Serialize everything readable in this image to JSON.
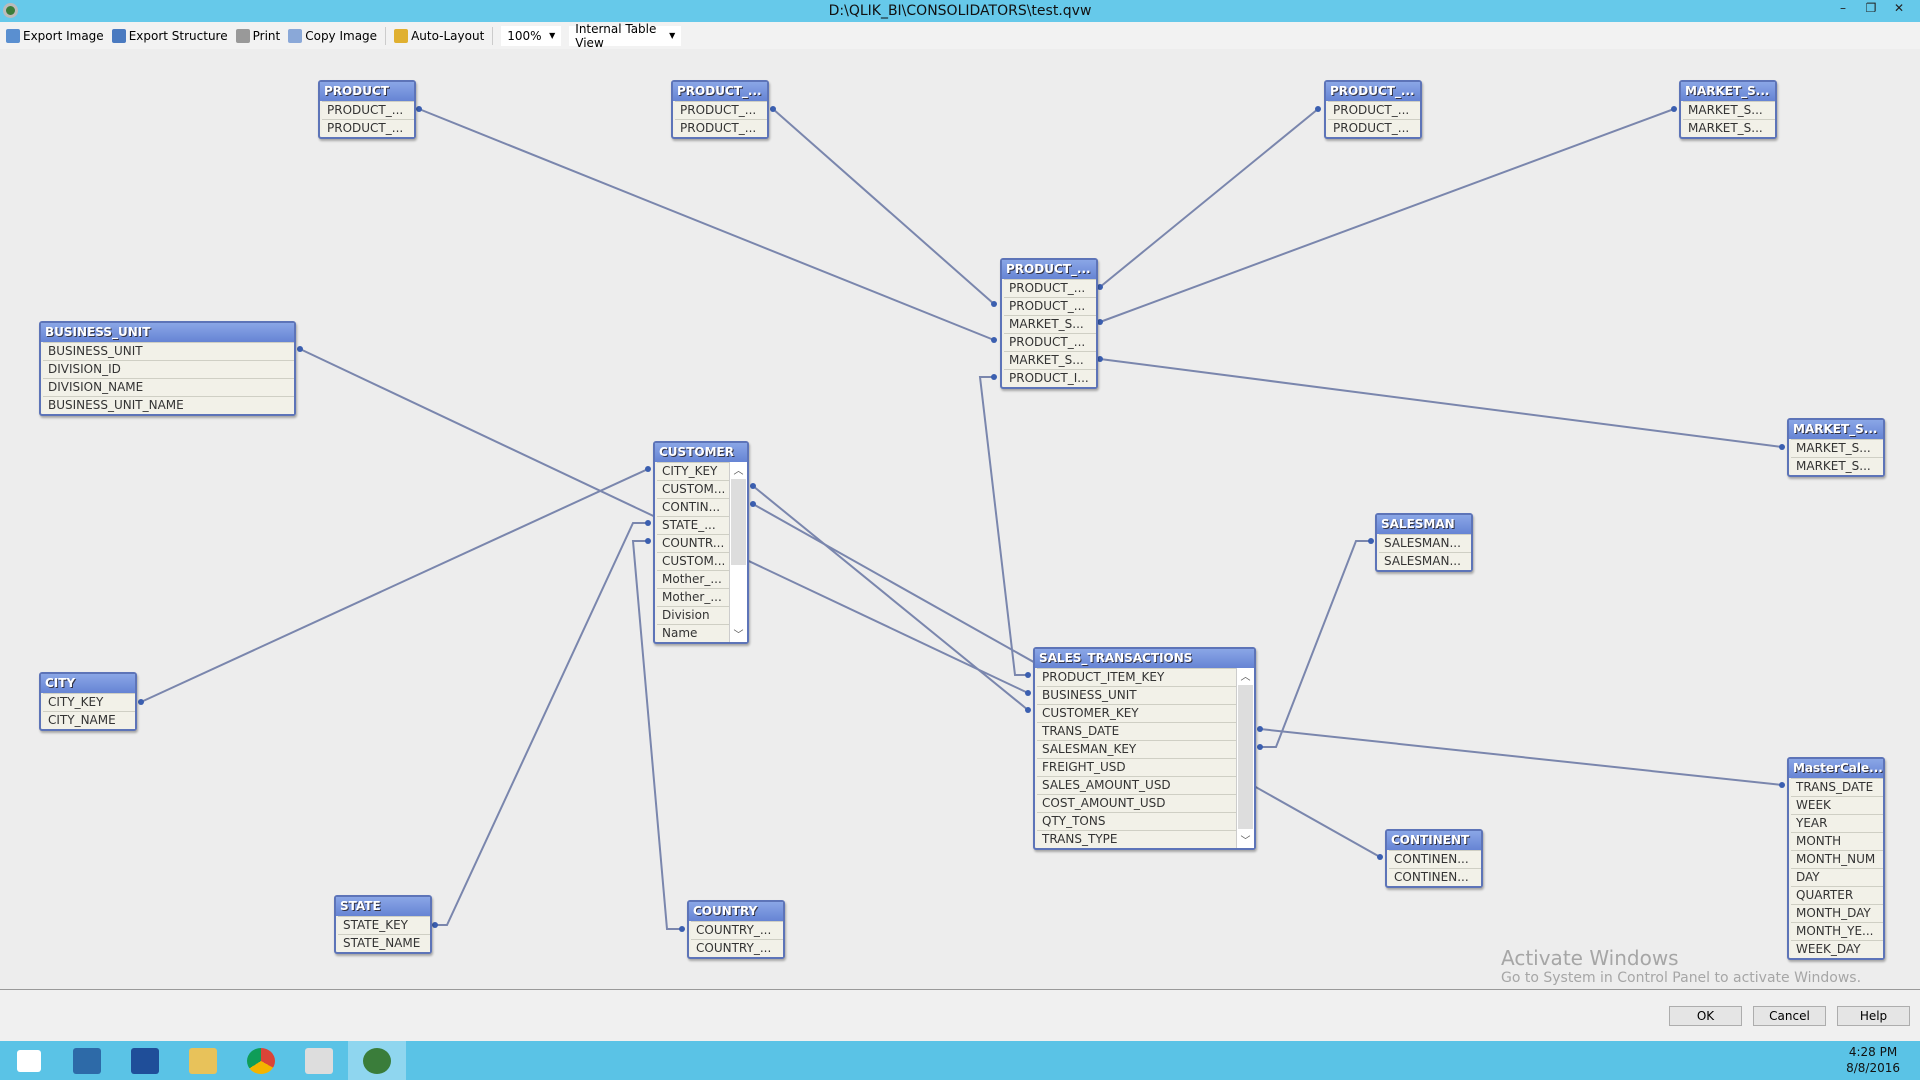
{
  "window": {
    "title": "D:\\QLIK_BI\\CONSOLIDATORS\\test.qvw",
    "minimize": "–",
    "restore": "❐",
    "close": "✕"
  },
  "toolbar": {
    "export_image": "Export Image",
    "export_structure": "Export Structure",
    "print": "Print",
    "copy_image": "Copy Image",
    "auto_layout": "Auto-Layout",
    "zoom": "100%",
    "view": "Internal Table View"
  },
  "tables": [
    {
      "name": "PRODUCT",
      "fields": [
        "PRODUCT_...",
        "PRODUCT_..."
      ]
    },
    {
      "name": "PRODUCT_...",
      "fields": [
        "PRODUCT_...",
        "PRODUCT_..."
      ]
    },
    {
      "name": "PRODUCT_...",
      "fields": [
        "PRODUCT_...",
        "PRODUCT_..."
      ]
    },
    {
      "name": "MARKET_S...",
      "fields": [
        "MARKET_S...",
        "MARKET_S..."
      ]
    },
    {
      "name": "PRODUCT_...",
      "fields": [
        "PRODUCT_...",
        "PRODUCT_...",
        "MARKET_S...",
        "PRODUCT_...",
        "MARKET_S...",
        "PRODUCT_I..."
      ]
    },
    {
      "name": "BUSINESS_UNIT",
      "fields": [
        "BUSINESS_UNIT",
        "DIVISION_ID",
        "DIVISION_NAME",
        "BUSINESS_UNIT_NAME"
      ]
    },
    {
      "name": "CUSTOMER",
      "fields": [
        "CITY_KEY",
        "CUSTOM...",
        "CONTIN...",
        "STATE_...",
        "COUNTR...",
        "CUSTOM...",
        "Mother_...",
        "Mother_...",
        "Division",
        "Name"
      ],
      "scroll": true
    },
    {
      "name": "MARKET_S...",
      "fields": [
        "MARKET_S...",
        "MARKET_S..."
      ]
    },
    {
      "name": "SALESMAN",
      "fields": [
        "SALESMAN...",
        "SALESMAN..."
      ]
    },
    {
      "name": "SALES_TRANSACTIONS",
      "fields": [
        "PRODUCT_ITEM_KEY",
        "BUSINESS_UNIT",
        "CUSTOMER_KEY",
        "TRANS_DATE",
        "SALESMAN_KEY",
        "FREIGHT_USD",
        "SALES_AMOUNT_USD",
        "COST_AMOUNT_USD",
        "QTY_TONS",
        "TRANS_TYPE"
      ],
      "scroll": true
    },
    {
      "name": "CITY",
      "fields": [
        "CITY_KEY",
        "CITY_NAME"
      ]
    },
    {
      "name": "MasterCale...",
      "fields": [
        "TRANS_DATE",
        "WEEK",
        "YEAR",
        "MONTH",
        "MONTH_NUM",
        "DAY",
        "QUARTER",
        "MONTH_DAY",
        "MONTH_YE...",
        "WEEK_DAY"
      ]
    },
    {
      "name": "CONTINENT",
      "fields": [
        "CONTINEN...",
        "CONTINEN..."
      ]
    },
    {
      "name": "STATE",
      "fields": [
        "STATE_KEY",
        "STATE_NAME"
      ]
    },
    {
      "name": "COUNTRY",
      "fields": [
        "COUNTRY_...",
        "COUNTRY_..."
      ]
    }
  ],
  "watermark": {
    "line1": "Activate Windows",
    "line2": "Go to System in Control Panel to activate Windows."
  },
  "dialog": {
    "ok": "OK",
    "cancel": "Cancel",
    "help": "Help"
  },
  "clock": {
    "time": "4:28 PM",
    "date": "8/8/2016"
  },
  "colors": {
    "header": "#6d8bd8",
    "link": "#7a86ad",
    "titlebar": "#66c9ea"
  }
}
